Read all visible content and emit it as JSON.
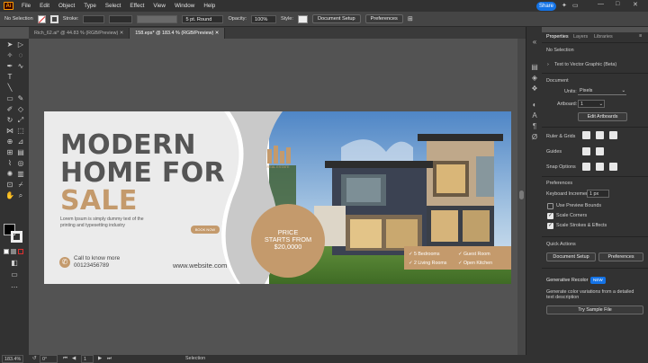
{
  "menubar": {
    "logo": "Ai",
    "items": [
      "File",
      "Edit",
      "Object",
      "Type",
      "Select",
      "Effect",
      "View",
      "Window",
      "Help"
    ],
    "share_label": "Share",
    "win_min": "—",
    "win_max": "□",
    "win_close": "✕"
  },
  "control": {
    "selection": "No Selection",
    "stroke_label": "Stroke:",
    "brush": "5 pt. Round",
    "opacity_label": "Opacity:",
    "opacity_value": "100%",
    "style_label": "Style:",
    "doc_setup": "Document Setup",
    "preferences": "Preferences"
  },
  "tabs": [
    {
      "label": "Rich_62.ai* @ 44.83 % (RGB/Preview)",
      "close": "✕"
    },
    {
      "label": "158.eps* @ 183.4 % (RGB/Preview)",
      "close": "✕"
    }
  ],
  "panel": {
    "tabs": [
      "Properties",
      "Layers",
      "Libraries"
    ],
    "no_selection": "No Selection",
    "text_to_vector": "Text to Vector Graphic (Beta)",
    "document_heading": "Document",
    "units_label": "Units:",
    "units_value": "Pixels",
    "artboard_label": "Artboard:",
    "artboard_value": "1",
    "edit_artboards": "Edit Artboards",
    "ruler_grids": "Ruler & Grids",
    "guides": "Guides",
    "snap_options": "Snap Options",
    "preferences_heading": "Preferences",
    "keyboard_increment_label": "Keyboard Increment:",
    "keyboard_increment_value": "1 px",
    "use_preview_bounds": "Use Preview Bounds",
    "scale_corners": "Scale Corners",
    "scale_strokes": "Scale Strokes & Effects",
    "quick_actions": "Quick Actions",
    "qa_doc_setup": "Document Setup",
    "qa_preferences": "Preferences",
    "gen_recolor": "Generative Recolor",
    "new_badge": "NEW",
    "gen_desc": "Generate color variations from a detailed text description",
    "try_sample": "Try Sample File"
  },
  "artwork": {
    "headline_1": "MODERN",
    "headline_2": "HOME FOR",
    "headline_3": "SALE",
    "body": "Lorem Ipsum is simply dummy text of the printing and typesetting industry",
    "call_label": "Call to know more",
    "phone": "00123456789",
    "book_now": "BOOK NOW",
    "website": "www.website.com",
    "logo_text": "REAL ESTATE",
    "price_line1": "PRICE",
    "price_line2": "STARTS FROM",
    "price_value": "$20,0000",
    "features": [
      "5 Bedrooms",
      "Guest Room",
      "2 Living Rooms",
      "Open Kitchen"
    ],
    "features_check": "✓",
    "phone_glyph": "✆"
  },
  "status": {
    "zoom": "183.4%",
    "angle": "0°",
    "page": "1",
    "mode": "Selection"
  },
  "colors": {
    "accent": "#1473e6",
    "tan": "#c49a6c",
    "headline": "#555555",
    "gray_shape": "#c9c9c9",
    "light_shape": "#ebebeb"
  }
}
